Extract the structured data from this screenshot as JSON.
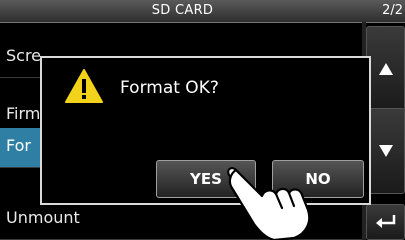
{
  "header": {
    "title": "SD CARD",
    "page_indicator": "2/2"
  },
  "menu": {
    "items": [
      {
        "label": "Scre"
      },
      {
        "label": "Firm"
      },
      {
        "label": "For"
      },
      {
        "label": "Unmount"
      }
    ]
  },
  "dialog": {
    "message": "Format OK?",
    "icon": "warning-icon",
    "yes_label": "YES",
    "no_label": "NO"
  },
  "colors": {
    "accent": "#2f7fa5",
    "warning_fill": "#f2d21a"
  }
}
